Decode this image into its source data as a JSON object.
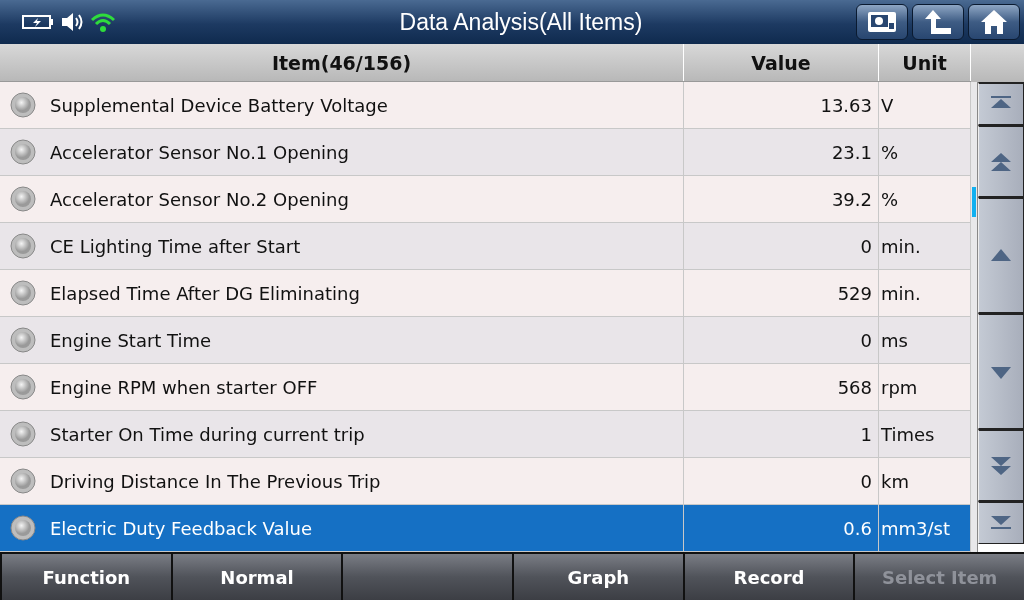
{
  "window": {
    "title": "Data Analysis(All Items)"
  },
  "table": {
    "columns": [
      "Item(46/156)",
      "Value",
      "Unit"
    ],
    "rows": [
      {
        "name": "Supplemental Device Battery Voltage",
        "value": "13.63",
        "unit": "V",
        "selected": false
      },
      {
        "name": "Accelerator Sensor No.1 Opening",
        "value": "23.1",
        "unit": "%",
        "selected": false
      },
      {
        "name": "Accelerator Sensor No.2 Opening",
        "value": "39.2",
        "unit": "%",
        "selected": false
      },
      {
        "name": "CE Lighting Time after Start",
        "value": "0",
        "unit": "min.",
        "selected": false
      },
      {
        "name": "Elapsed Time After DG Eliminating",
        "value": "529",
        "unit": "min.",
        "selected": false
      },
      {
        "name": "Engine Start Time",
        "value": "0",
        "unit": "ms",
        "selected": false
      },
      {
        "name": "Engine RPM when starter OFF",
        "value": "568",
        "unit": "rpm",
        "selected": false
      },
      {
        "name": "Starter On Time during current trip",
        "value": "1",
        "unit": "Times",
        "selected": false
      },
      {
        "name": "Driving Distance In The Previous Trip",
        "value": "0",
        "unit": "km",
        "selected": false
      },
      {
        "name": "Electric Duty Feedback Value",
        "value": "0.6",
        "unit": "mm3/st",
        "selected": true
      }
    ]
  },
  "footer": {
    "buttons": [
      {
        "kind": "text",
        "label": "Function",
        "disabled": false
      },
      {
        "kind": "text",
        "label": "Normal",
        "disabled": false
      },
      {
        "kind": "blank"
      },
      {
        "kind": "text",
        "label": "Graph",
        "disabled": false
      },
      {
        "kind": "text",
        "label": "Record",
        "disabled": false
      },
      {
        "kind": "text",
        "label": "Select Item",
        "disabled": true
      }
    ]
  }
}
